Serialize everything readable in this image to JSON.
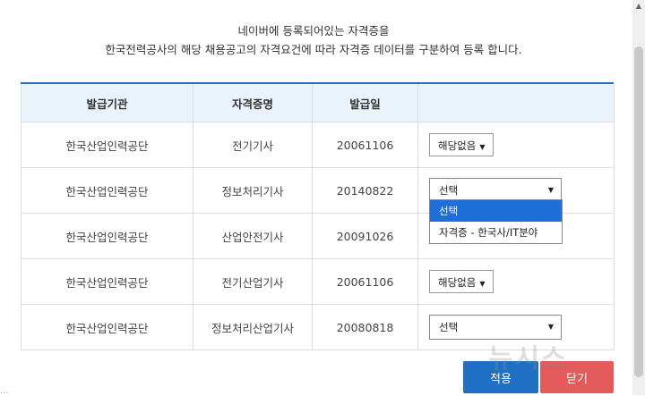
{
  "intro": {
    "line1": "네이버에 등록되어있는 자격증을",
    "line2": "한국전력공사의 해당 채용공고의 자격요건에 따라 자격증 데이터를 구분하여 등록 합니다."
  },
  "table": {
    "headers": [
      "발급기관",
      "자격증명",
      "발급일",
      ""
    ],
    "rows": [
      {
        "issuer": "한국산업인력공단",
        "name": "전기기사",
        "date": "20061106",
        "select": "해당없음"
      },
      {
        "issuer": "한국산업인력공단",
        "name": "정보처리기사",
        "date": "20140822",
        "select": "선택"
      },
      {
        "issuer": "한국산업인력공단",
        "name": "산업안전기사",
        "date": "20091026",
        "select": ""
      },
      {
        "issuer": "한국산업인력공단",
        "name": "전기산업기사",
        "date": "20061106",
        "select": "해당없음"
      },
      {
        "issuer": "한국산업인력공단",
        "name": "정보처리산업기사",
        "date": "20080818",
        "select": "선택"
      }
    ]
  },
  "dropdown": {
    "options": [
      "선택",
      "자격증 - 한국사/IT분야"
    ]
  },
  "buttons": {
    "apply": "적용",
    "close": "닫기"
  },
  "watermark": "뉴시스",
  "bottom_fragment": "...",
  "colors": {
    "accent": "#1f6fc4",
    "close": "#e35a5a",
    "dropdown_active": "#1e6fd8",
    "header_bg": "#eaf2fb"
  }
}
